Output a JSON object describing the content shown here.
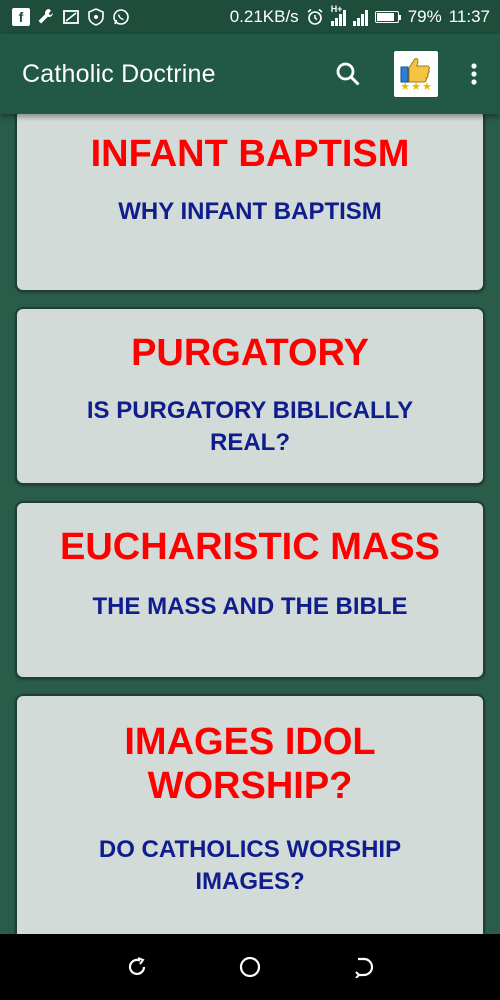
{
  "status_bar": {
    "speed": "0.21KB/s",
    "network": "H+",
    "battery": "79%",
    "time": "11:37",
    "icons": [
      "facebook-icon",
      "wrench-icon",
      "screenshot-icon",
      "shield-icon",
      "whatsapp-icon",
      "alarm-icon",
      "signal-icon",
      "signal-icon",
      "battery-icon"
    ]
  },
  "app_bar": {
    "title": "Catholic Doctrine",
    "actions": [
      "search-icon",
      "rate-app-icon",
      "more-vert-icon"
    ]
  },
  "cards": [
    {
      "title": "INFANT BAPTISM",
      "subtitle": "WHY INFANT BAPTISM"
    },
    {
      "title": "PURGATORY",
      "subtitle": "IS PURGATORY BIBLICALLY REAL?"
    },
    {
      "title": "EUCHARISTIC MASS",
      "subtitle": "THE MASS AND THE BIBLE"
    },
    {
      "title": "IMAGES IDOL WORSHIP?",
      "subtitle": "DO CATHOLICS WORSHIP IMAGES?"
    }
  ],
  "colors": {
    "app_bar": "#215846",
    "background": "#2a5c4a",
    "card": "#d2dbd8",
    "card_title": "#ff0000",
    "card_subtitle": "#0f1e8c"
  },
  "nav_bar": {
    "buttons": [
      "recent-apps-icon",
      "home-icon",
      "back-icon"
    ]
  }
}
